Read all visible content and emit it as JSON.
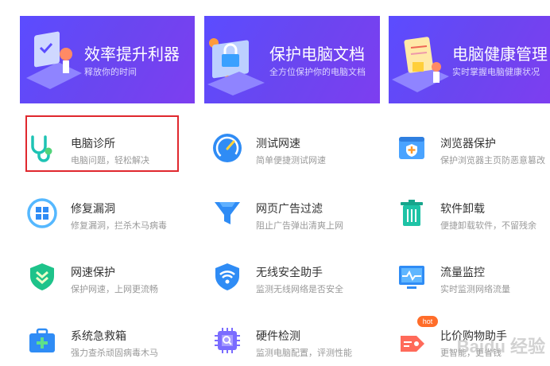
{
  "banners": [
    {
      "title": "效率提升利器",
      "subtitle": "释放你的时间"
    },
    {
      "title": "保护电脑文档",
      "subtitle": "全方位保护你的电脑文档"
    },
    {
      "title": "电脑健康管理",
      "subtitle": "实时掌握电脑健康状况"
    }
  ],
  "tools": [
    {
      "name": "电脑诊所",
      "desc": "电脑问题，轻松解决",
      "icon": "stethoscope-icon"
    },
    {
      "name": "测试网速",
      "desc": "简单便捷测试网速",
      "icon": "speedometer-icon"
    },
    {
      "name": "浏览器保护",
      "desc": "保护浏览器主页防恶意篡改",
      "icon": "browser-shield-icon"
    },
    {
      "name": "修复漏洞",
      "desc": "修复漏洞，拦杀木马病毒",
      "icon": "windows-repair-icon"
    },
    {
      "name": "网页广告过滤",
      "desc": "阻止广告弹出清爽上网",
      "icon": "ad-filter-icon"
    },
    {
      "name": "软件卸载",
      "desc": "便捷卸载软件，不留残余",
      "icon": "trash-icon"
    },
    {
      "name": "网速保护",
      "desc": "保护网速，上网更流畅",
      "icon": "speed-shield-icon"
    },
    {
      "name": "无线安全助手",
      "desc": "监测无线网络是否安全",
      "icon": "wifi-shield-icon"
    },
    {
      "name": "流量监控",
      "desc": "实时监测网络流量",
      "icon": "monitor-icon"
    },
    {
      "name": "系统急救箱",
      "desc": "强力查杀顽固病毒木马",
      "icon": "first-aid-icon"
    },
    {
      "name": "硬件检测",
      "desc": "监测电脑配置，评测性能",
      "icon": "chip-icon"
    },
    {
      "name": "比价购物助手",
      "desc": "更智能，更省钱",
      "icon": "price-tag-icon"
    }
  ],
  "badge": {
    "text": "hot"
  },
  "watermark": "Baidu 经验",
  "colors": {
    "banner": "#5b4cff",
    "highlight": "#e0282e",
    "accent_blue": "#2f8cf5",
    "accent_green": "#2ac17a"
  }
}
